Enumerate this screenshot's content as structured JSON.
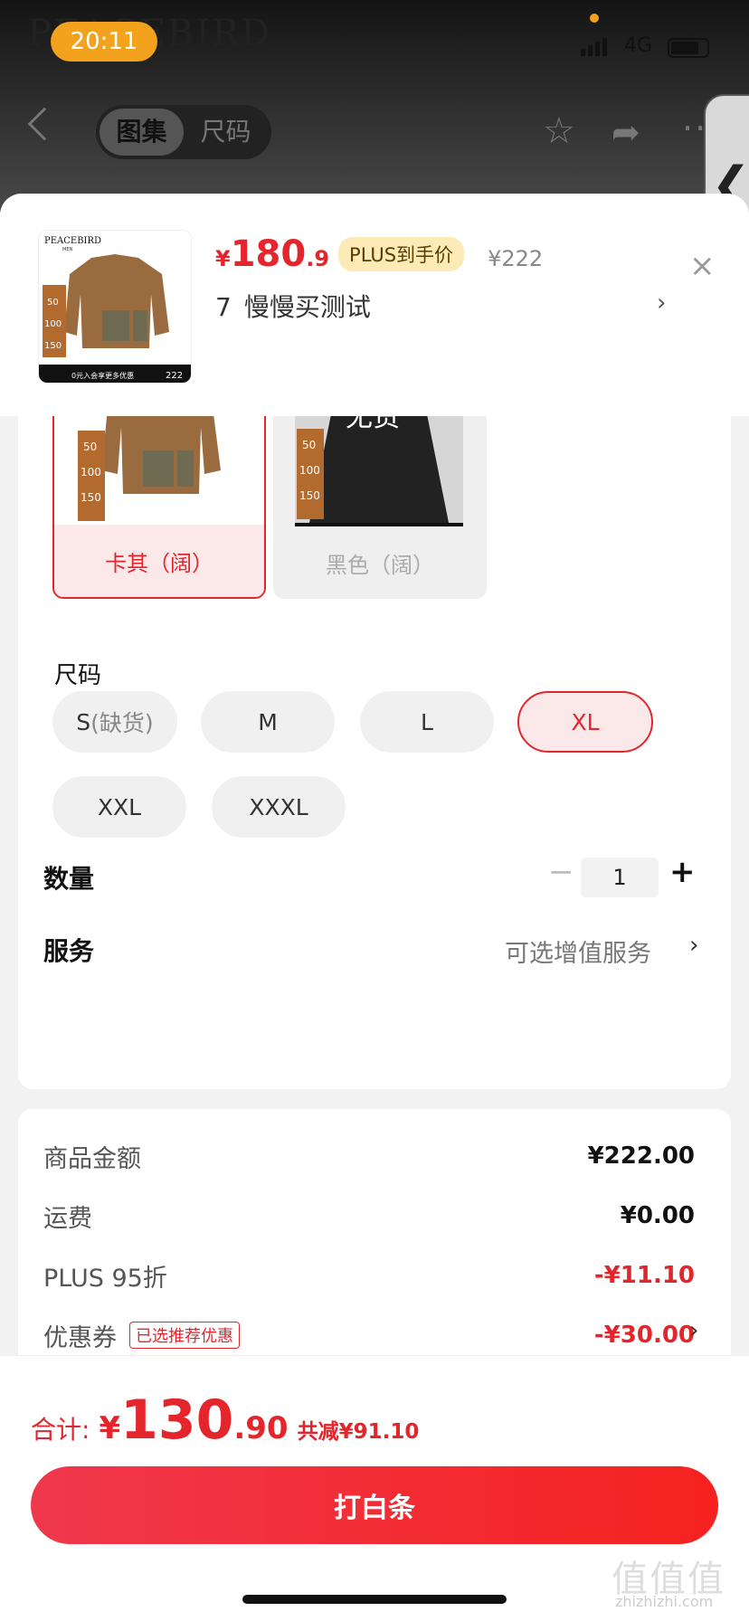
{
  "status_bar": {
    "time": "20:11",
    "network": "4G"
  },
  "app_header": {
    "brand": "PEACEBIRD",
    "brand_sub": "MEN",
    "tabs": [
      {
        "label": "图集",
        "active": true
      },
      {
        "label": "尺码",
        "active": false
      }
    ],
    "icons": [
      "back-icon",
      "star-icon",
      "share-icon",
      "more-icon"
    ]
  },
  "product": {
    "currency": "¥",
    "price_int": "180",
    "price_dec": ".9",
    "plus_badge": "PLUS到手价",
    "original_price": "¥222",
    "address_num": "7",
    "address_text": "慢慢买测试",
    "thumb_brand": "PEACEBIRD",
    "thumb_brand_sub": "MEN",
    "thumb_coupons": [
      "50",
      "100",
      "150"
    ],
    "thumb_banner": "0元入会享更多优惠",
    "thumb_price": "222"
  },
  "colors": [
    {
      "label": "卡其（阔）",
      "selected": true,
      "available": true,
      "fill": "#9a6b3f"
    },
    {
      "label": "黑色（阔）",
      "selected": false,
      "available": false,
      "fill": "#222222",
      "status": "无货"
    }
  ],
  "size": {
    "title": "尺码",
    "options": [
      {
        "label": "S",
        "note": "(缺货)",
        "selected": false
      },
      {
        "label": "M",
        "selected": false
      },
      {
        "label": "L",
        "selected": false
      },
      {
        "label": "XL",
        "selected": true
      },
      {
        "label": "XXL",
        "selected": false
      },
      {
        "label": "XXXL",
        "selected": false
      }
    ]
  },
  "quantity": {
    "label": "数量",
    "value": "1",
    "minus": "−",
    "plus": "+"
  },
  "service": {
    "label": "服务",
    "value": "可选增值服务"
  },
  "fees": [
    {
      "label": "商品金额",
      "value": "¥222.00",
      "red": false
    },
    {
      "label": "运费",
      "value": "¥0.00",
      "red": false
    },
    {
      "label": "PLUS 95折",
      "value": "-¥11.10",
      "red": true
    },
    {
      "label": "优惠券",
      "tag": "已选推荐优惠",
      "value": "-¥30.00",
      "red": true
    }
  ],
  "total": {
    "label": "合计:",
    "currency": "¥",
    "int": "130",
    "dec": ".90",
    "saving": "共减¥91.10"
  },
  "pay_button": "打白条",
  "watermark": {
    "main": "值值值",
    "sub": "zhizhizhi.com"
  },
  "theme": {
    "accent": "#e4262c",
    "plus_bg": "#fcebb6"
  }
}
